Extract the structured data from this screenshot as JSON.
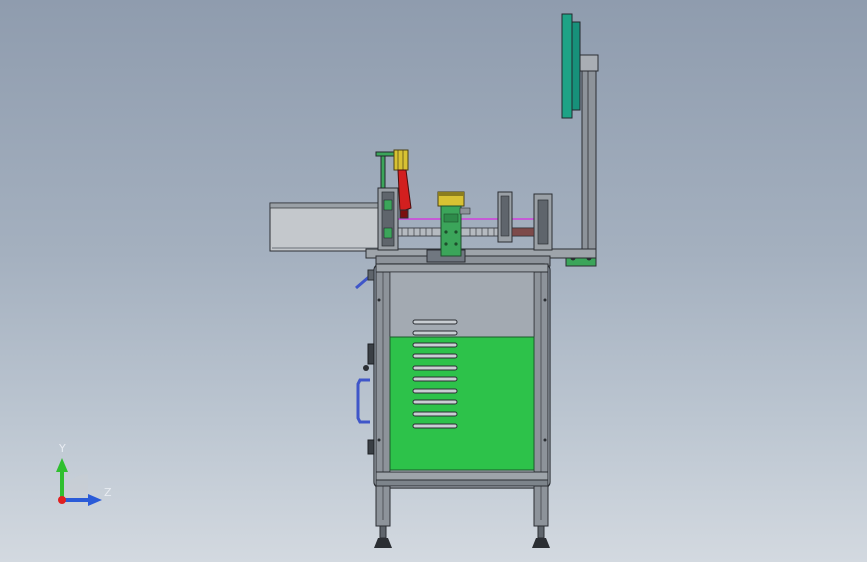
{
  "viewport": {
    "background_top": "#8f9cae",
    "background_bottom": "#d3d9e0"
  },
  "triad": {
    "y_label": "Y",
    "z_label": "Z",
    "y_color": "#2fbf2f",
    "z_color": "#2a5bd8",
    "x_color": "#e02020"
  },
  "colors": {
    "frame": "#8d939a",
    "frame_edge": "#2b2e33",
    "panel_green": "#2dc24a",
    "part_green": "#3ba55a",
    "teal": "#1ea386",
    "red": "#d21f1f",
    "yellow": "#d8c233",
    "blue": "#3f56c9",
    "magenta": "#c65ad6"
  }
}
